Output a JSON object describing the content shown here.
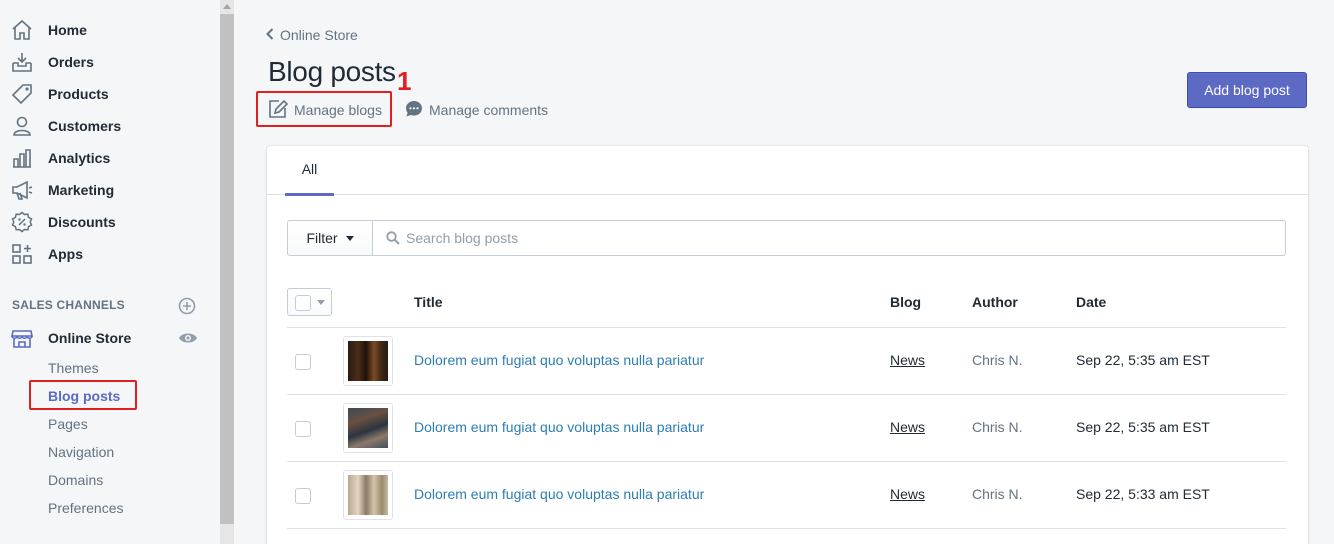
{
  "sidebar": {
    "items": [
      {
        "label": "Home",
        "icon": "home-icon"
      },
      {
        "label": "Orders",
        "icon": "orders-icon"
      },
      {
        "label": "Products",
        "icon": "tag-icon"
      },
      {
        "label": "Customers",
        "icon": "person-icon"
      },
      {
        "label": "Analytics",
        "icon": "bar-chart-icon"
      },
      {
        "label": "Marketing",
        "icon": "megaphone-icon"
      },
      {
        "label": "Discounts",
        "icon": "discount-icon"
      },
      {
        "label": "Apps",
        "icon": "apps-icon"
      }
    ],
    "sales_channels_label": "SALES CHANNELS",
    "online_store_label": "Online Store",
    "sub_items": [
      "Themes",
      "Blog posts",
      "Pages",
      "Navigation",
      "Domains",
      "Preferences"
    ],
    "active_sub_item": "Blog posts"
  },
  "header": {
    "breadcrumb": "Online Store",
    "title": "Blog posts",
    "annotation_number": "1",
    "manage_blogs": "Manage blogs",
    "manage_comments": "Manage comments",
    "add_button": "Add blog post"
  },
  "tabs": [
    {
      "label": "All",
      "selected": true
    }
  ],
  "filter": {
    "button_label": "Filter",
    "search_placeholder": "Search blog posts"
  },
  "table": {
    "columns": [
      "Title",
      "Blog",
      "Author",
      "Date"
    ],
    "rows": [
      {
        "title": "Dolorem eum fugiat quo voluptas nulla pariatur",
        "blog": "News",
        "author": "Chris N.",
        "date": "Sep 22, 5:35 am EST"
      },
      {
        "title": "Dolorem eum fugiat quo voluptas nulla pariatur",
        "blog": "News",
        "author": "Chris N.",
        "date": "Sep 22, 5:35 am EST"
      },
      {
        "title": "Dolorem eum fugiat quo voluptas nulla pariatur",
        "blog": "News",
        "author": "Chris N.",
        "date": "Sep 22, 5:33 am EST"
      }
    ]
  },
  "colors": {
    "accent": "#5c6ac4",
    "link": "#2c7eb3",
    "annotation": "#e02020"
  }
}
